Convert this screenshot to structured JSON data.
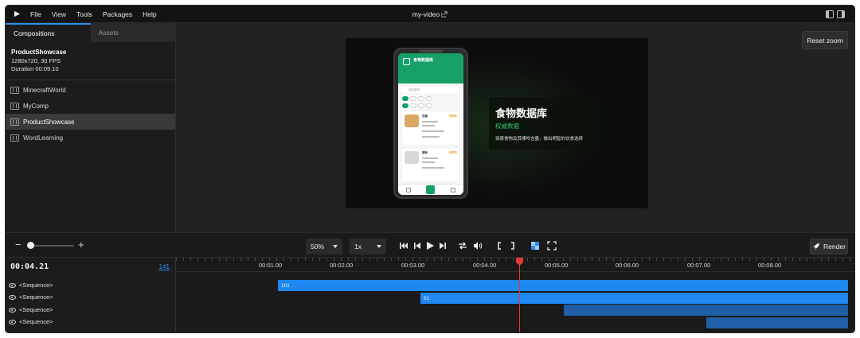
{
  "menubar": {
    "items": [
      "File",
      "View",
      "Tools",
      "Packages",
      "Help"
    ],
    "title": "my-video"
  },
  "left_panel": {
    "tabs": [
      "Compositions",
      "Assets"
    ],
    "selected": {
      "name": "ProductShowcase",
      "resolution": "1280x720, 30 FPS",
      "duration": "Duration 00:09.10"
    },
    "compositions": [
      "MinecraftWorld",
      "MyComp",
      "ProductShowcase",
      "WordLearning"
    ]
  },
  "preview": {
    "reset_zoom": "Reset zoom",
    "phone": {
      "app_title": "食物数据库",
      "search_placeholder": "搜索食物",
      "food_names": [
        "豆腐",
        "面粉"
      ]
    },
    "hero": {
      "title": "食物数据库",
      "subtitle": "权威数据",
      "description": "探索食物及其嘌呤含量，做出明智的饮食选择"
    }
  },
  "toolbar": {
    "zoom_level": "50%",
    "playback_rate": "1x",
    "render_label": "Render"
  },
  "timeline": {
    "timecode": "00:04.21",
    "frame": "141",
    "ticks": [
      "00:01.00",
      "00:02.00",
      "00:03.00",
      "00:04.00",
      "00:05.00",
      "00:06.00",
      "00:07.00",
      "00:08.00"
    ],
    "tracks": [
      {
        "label": "<Sequence>",
        "clip_label": "101"
      },
      {
        "label": "<Sequence>",
        "clip_label": "61"
      },
      {
        "label": "<Sequence>",
        "clip_label": ""
      },
      {
        "label": "<Sequence>",
        "clip_label": ""
      }
    ]
  },
  "colors": {
    "accent": "#2d8cf0",
    "clip_active": "#1e88f0",
    "clip_dim": "#1f5fa8",
    "playhead": "#e53935",
    "brand_green": "#17a06a"
  }
}
